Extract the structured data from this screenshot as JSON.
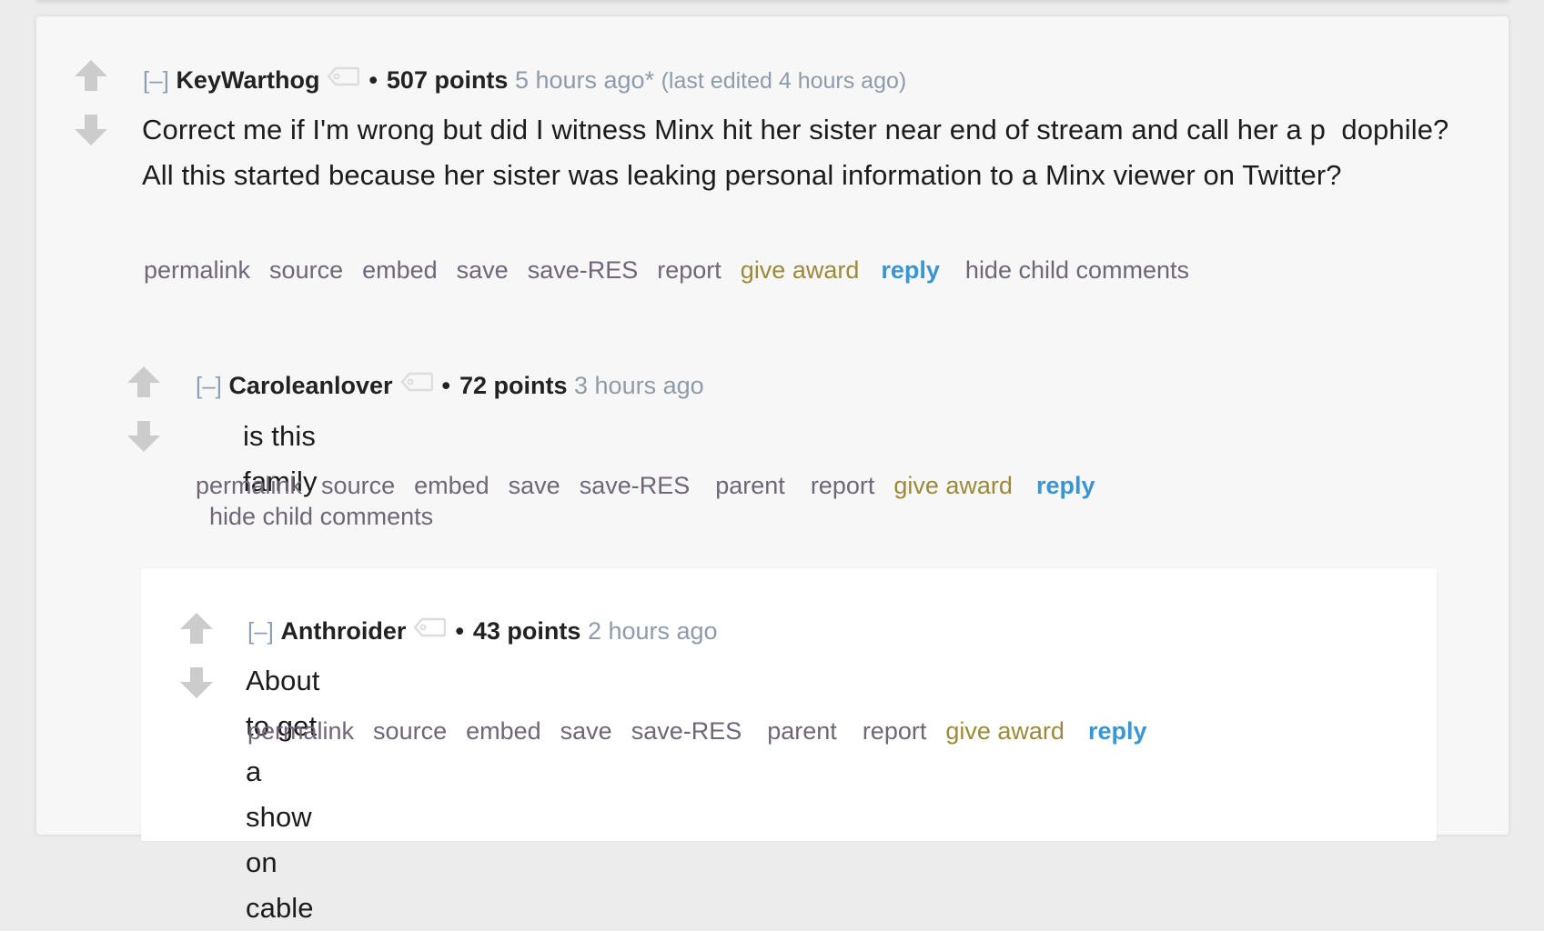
{
  "colors": {
    "page_bg": "#ececec",
    "card_bg": "#f7f7f7",
    "nested_card_bg": "#ffffff",
    "action_link": "#706677",
    "award_link": "#9a8a3a",
    "reply_link": "#3b95d1",
    "timestamp": "#8f9ba8",
    "vote_arrow": "#cccccc"
  },
  "icons": {
    "upvote": "arrow-up-icon",
    "downvote": "arrow-down-icon",
    "tag": "tag-icon"
  },
  "comments": [
    {
      "collapse_label": "[–]",
      "author": "KeyWarthog",
      "bullet": "•",
      "score": "507 points",
      "time": "5 hours ago*",
      "edited": "(last edited 4 hours ago)",
      "body": "Correct me if I'm wrong but did I witness Minx hit her sister near end of stream and call her a p  dophile? All this started because her sister was leaking personal information to a Minx viewer on Twitter?",
      "actions": {
        "permalink": "permalink",
        "source": "source",
        "embed": "embed",
        "save": "save",
        "save_res": "save-RES",
        "report": "report",
        "give_award": "give award",
        "reply": "reply",
        "hide_child": "hide child comments"
      }
    },
    {
      "collapse_label": "[–]",
      "author": "Caroleanlover",
      "bullet": "•",
      "score": "72 points",
      "time": "3 hours ago",
      "body": "is this family",
      "actions": {
        "permalink": "permalink",
        "source": "source",
        "embed": "embed",
        "save": "save",
        "save_res": "save-RES",
        "parent": "parent",
        "report": "report",
        "give_award": "give award",
        "reply": "reply",
        "hide_child": "hide child comments"
      }
    },
    {
      "collapse_label": "[–]",
      "author": "Anthroider",
      "bullet": "•",
      "score": "43 points",
      "time": "2 hours ago",
      "body": "About to get a show on cable",
      "actions": {
        "permalink": "permalink",
        "source": "source",
        "embed": "embed",
        "save": "save",
        "save_res": "save-RES",
        "parent": "parent",
        "report": "report",
        "give_award": "give award",
        "reply": "reply"
      }
    }
  ]
}
